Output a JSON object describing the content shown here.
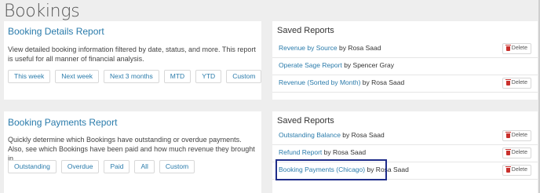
{
  "page": {
    "title": "Bookings"
  },
  "booking_details": {
    "title": "Booking Details Report",
    "description": "View detailed booking information filtered by date, status, and more. This report is useful for all manner of financial analysis.",
    "buttons": [
      "This week",
      "Next week",
      "Next 3 months",
      "MTD",
      "YTD",
      "Custom"
    ]
  },
  "booking_payments": {
    "title": "Booking Payments Report",
    "description": "Quickly determine which Bookings have outstanding or overdue payments. Also, see which Bookings have been paid and how much revenue they brought in.",
    "buttons": [
      "Outstanding",
      "Overdue",
      "Paid",
      "All",
      "Custom"
    ]
  },
  "saved_reports_top": {
    "title": "Saved Reports",
    "items": [
      {
        "name": "Revenue by Source",
        "by": "by Rosa Saad",
        "delete": true
      },
      {
        "name": "Operate Sage Report",
        "by": "by Spencer Gray",
        "delete": false
      },
      {
        "name": "Revenue (Sorted by Month)",
        "by": "by Rosa Saad",
        "delete": true
      }
    ]
  },
  "saved_reports_bottom": {
    "title": "Saved Reports",
    "items": [
      {
        "name": "Outstanding Balance",
        "by": "by Rosa Saad",
        "delete": true
      },
      {
        "name": "Refund Report",
        "by": "by Rosa Saad",
        "delete": true
      },
      {
        "name": "Booking Payments (Chicago)",
        "by": "by Rosa Saad",
        "delete": true
      }
    ]
  },
  "delete_label": "Delete",
  "colors": {
    "link": "#2a7bab",
    "highlight": "#1f2d8a",
    "trash": "#c9302c"
  }
}
